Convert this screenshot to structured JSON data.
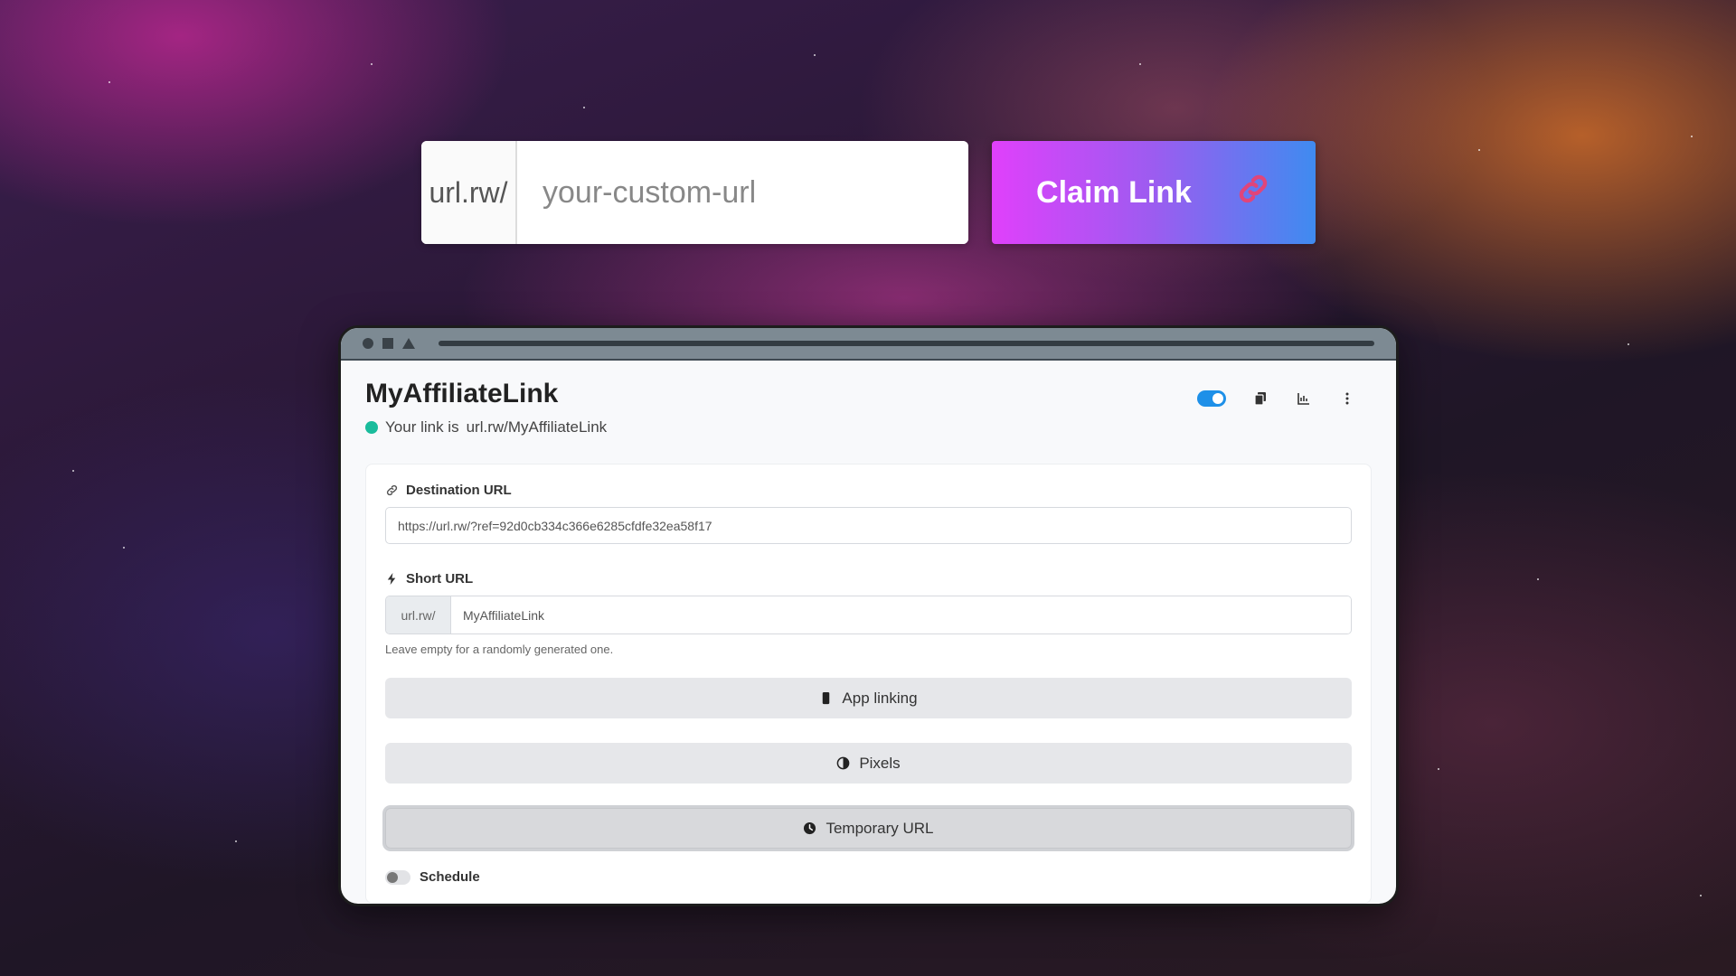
{
  "claim": {
    "prefix": "url.rw/",
    "placeholder": "your-custom-url",
    "button_label": "Claim Link",
    "button_icon": "link-icon",
    "gradient_start": "#e040fb",
    "gradient_end": "#3f8bf0"
  },
  "window": {
    "title": "MyAffiliateLink",
    "status_prefix": "Your link is",
    "status_link": "url.rw/MyAffiliateLink",
    "status_color": "#1abc9c",
    "toggle_on": true,
    "actions": [
      "toggle-switch",
      "copy-icon",
      "stats-icon",
      "more-icon"
    ]
  },
  "form": {
    "destination": {
      "label": "Destination URL",
      "icon": "link-icon",
      "value": "https://url.rw/?ref=92d0cb334c366e6285cfdfe32ea58f17"
    },
    "short_url": {
      "label": "Short URL",
      "icon": "bolt-icon",
      "prefix": "url.rw/",
      "value": "MyAffiliateLink",
      "help": "Leave empty for a randomly generated one."
    },
    "sections": [
      {
        "label": "App linking",
        "icon": "mobile-icon"
      },
      {
        "label": "Pixels",
        "icon": "half-circle-icon"
      },
      {
        "label": "Temporary URL",
        "icon": "clock-icon"
      }
    ],
    "schedule_label": "Schedule"
  }
}
